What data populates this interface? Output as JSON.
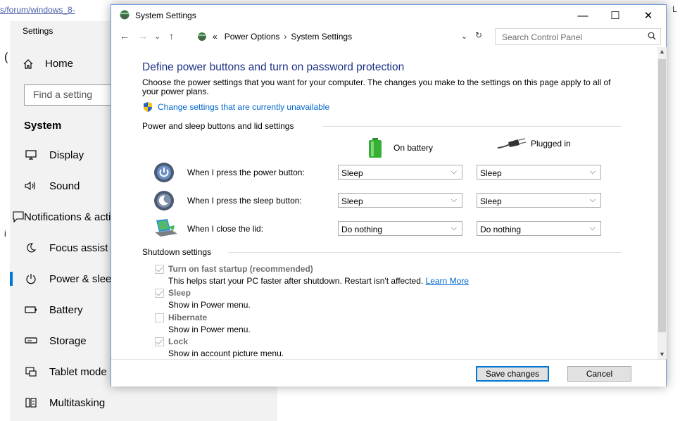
{
  "background": {
    "url_text": "s/forum/windows_8-",
    "url_edge": "L",
    "settings_title": "Settings",
    "home_label": "Home",
    "find_placeholder": "Find a setting",
    "section_title": "System",
    "nav": [
      {
        "label": "Display",
        "icon": "monitor-icon"
      },
      {
        "label": "Sound",
        "icon": "speaker-icon"
      },
      {
        "label": "Notifications & actions",
        "icon": "notification-icon"
      },
      {
        "label": "Focus assist",
        "icon": "moon-icon"
      },
      {
        "label": "Power & sleep",
        "icon": "power-icon",
        "active": true
      },
      {
        "label": "Battery",
        "icon": "battery-icon"
      },
      {
        "label": "Storage",
        "icon": "storage-icon"
      },
      {
        "label": "Tablet mode",
        "icon": "tablet-icon"
      },
      {
        "label": "Multitasking",
        "icon": "multitasking-icon"
      }
    ]
  },
  "window": {
    "title": "System Settings",
    "controls": {
      "minimize": "—",
      "maximize": "☐",
      "close": "✕"
    },
    "nav": {
      "back": "←",
      "forward": "→",
      "recent": "⌄",
      "up": "↑"
    },
    "breadcrumb": {
      "prefix": "«",
      "items": [
        "Power Options",
        "System Settings"
      ],
      "separator": "›"
    },
    "address_dropdown": "⌄",
    "refresh": "↻",
    "search_placeholder": "Search Control Panel"
  },
  "main": {
    "heading": "Define power buttons and turn on password protection",
    "description": "Choose the power settings that you want for your computer. The changes you make to the settings on this page apply to all of your power plans.",
    "change_link": "Change settings that are currently unavailable",
    "buttons_group": {
      "title": "Power and sleep buttons and lid settings",
      "col_battery": "On battery",
      "col_plugged": "Plugged in",
      "rows": [
        {
          "label": "When I press the power button:",
          "battery": "Sleep",
          "plugged": "Sleep"
        },
        {
          "label": "When I press the sleep button:",
          "battery": "Sleep",
          "plugged": "Sleep"
        },
        {
          "label": "When I close the lid:",
          "battery": "Do nothing",
          "plugged": "Do nothing"
        }
      ]
    },
    "shutdown_group": {
      "title": "Shutdown settings",
      "items": [
        {
          "label": "Turn on fast startup (recommended)",
          "checked": true,
          "desc": "This helps start your PC faster after shutdown. Restart isn't affected.",
          "link": "Learn More"
        },
        {
          "label": "Sleep",
          "checked": true,
          "desc": "Show in Power menu."
        },
        {
          "label": "Hibernate",
          "checked": false,
          "desc": "Show in Power menu."
        },
        {
          "label": "Lock",
          "checked": true,
          "desc": "Show in account picture menu."
        }
      ]
    }
  },
  "footer": {
    "save_label": "Save changes",
    "cancel_label": "Cancel"
  },
  "colors": {
    "heading": "#1e3287",
    "link": "#0066cc",
    "accent": "#0078d7"
  }
}
